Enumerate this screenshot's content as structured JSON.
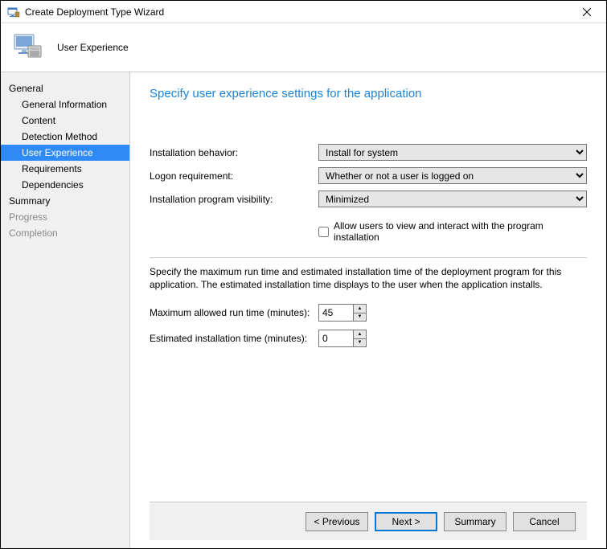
{
  "window": {
    "title": "Create Deployment Type Wizard"
  },
  "header": {
    "page_title": "User Experience"
  },
  "sidebar": {
    "items": [
      {
        "label": "General",
        "type": "group",
        "state": "normal"
      },
      {
        "label": "General Information",
        "type": "child",
        "state": "normal"
      },
      {
        "label": "Content",
        "type": "child",
        "state": "normal"
      },
      {
        "label": "Detection Method",
        "type": "child",
        "state": "normal"
      },
      {
        "label": "User Experience",
        "type": "child",
        "state": "selected"
      },
      {
        "label": "Requirements",
        "type": "child",
        "state": "normal"
      },
      {
        "label": "Dependencies",
        "type": "child",
        "state": "normal"
      },
      {
        "label": "Summary",
        "type": "group",
        "state": "normal"
      },
      {
        "label": "Progress",
        "type": "group",
        "state": "disabled"
      },
      {
        "label": "Completion",
        "type": "group",
        "state": "disabled"
      }
    ]
  },
  "main": {
    "heading": "Specify user experience settings for the application",
    "install_behavior_label": "Installation behavior:",
    "install_behavior_value": "Install for system",
    "logon_requirement_label": "Logon requirement:",
    "logon_requirement_value": "Whether or not a user is logged on",
    "visibility_label": "Installation program visibility:",
    "visibility_value": "Minimized",
    "allow_interact_label": "Allow users to view and interact with the program installation",
    "allow_interact_checked": false,
    "runtime_desc": "Specify the maximum run time and estimated installation time of the deployment program for this application. The estimated installation time displays to the user when the application installs.",
    "max_run_label": "Maximum allowed run time (minutes):",
    "max_run_value": "45",
    "est_time_label": "Estimated installation time (minutes):",
    "est_time_value": "0"
  },
  "footer": {
    "previous": "< Previous",
    "next": "Next >",
    "summary": "Summary",
    "cancel": "Cancel"
  }
}
